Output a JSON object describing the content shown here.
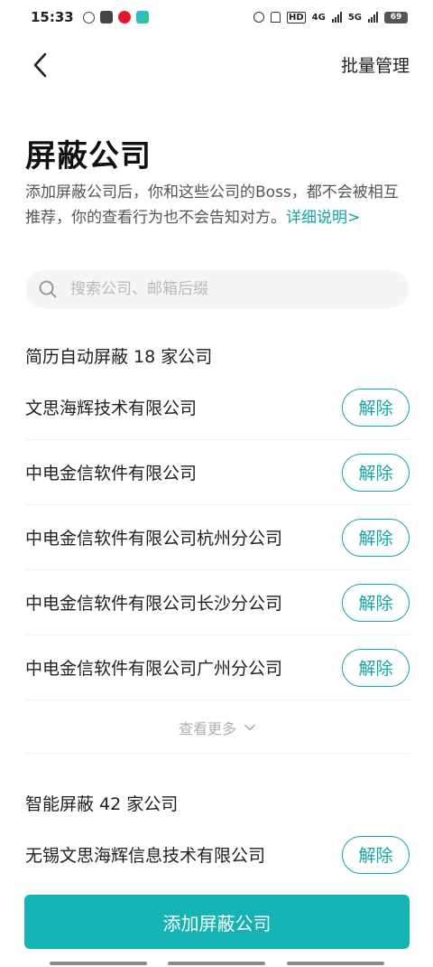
{
  "status_bar": {
    "time": "15:33",
    "battery": "69",
    "network_labels": [
      "HD",
      "4G",
      "5G"
    ]
  },
  "nav": {
    "batch_manage": "批量管理"
  },
  "page": {
    "title": "屏蔽公司",
    "description": "添加屏蔽公司后，你和这些公司的Boss，都不会被相互推荐，你的查看行为也不会告知对方。",
    "detail_link": "详细说明>"
  },
  "search": {
    "placeholder": "搜索公司、邮箱后缀",
    "value": ""
  },
  "resume_section": {
    "title": "简历自动屏蔽 18 家公司",
    "companies": [
      "文思海辉技术有限公司",
      "中电金信软件有限公司",
      "中电金信软件有限公司杭州分公司",
      "中电金信软件有限公司长沙分公司",
      "中电金信软件有限公司广州分公司"
    ],
    "remove_label": "解除",
    "view_more": "查看更多"
  },
  "smart_section": {
    "title": "智能屏蔽 42 家公司",
    "companies": [
      "无锡文思海辉信息技术有限公司"
    ],
    "remove_label": "解除"
  },
  "bottom": {
    "add_button": "添加屏蔽公司"
  },
  "colors": {
    "accent": "#16a3a6",
    "button_bg": "#16b3b4"
  }
}
